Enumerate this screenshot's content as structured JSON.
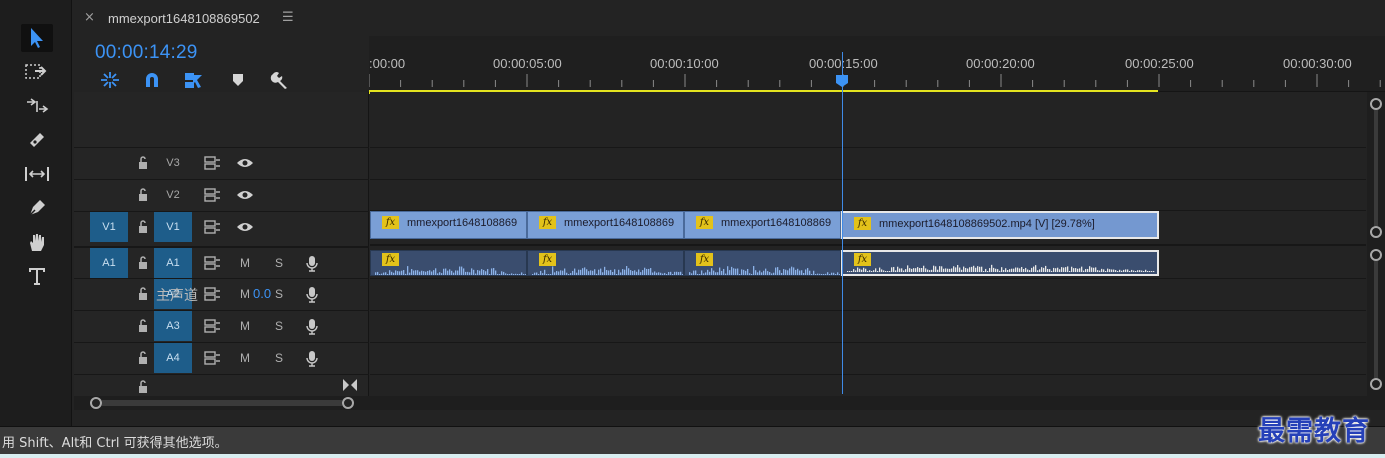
{
  "sequence": {
    "tab_close": "×",
    "title": "mmexport1648108869502",
    "tab_menu": "☰",
    "timecode": "00:00:14:29"
  },
  "ruler": {
    "labels": [
      ":00:00",
      "00:00:05:00",
      "00:00:10:00",
      "00:00:15:00",
      "00:00:20:00",
      "00:00:25:00",
      "00:00:30:00"
    ]
  },
  "tools": [
    "selection-tool",
    "track-select-tool",
    "ripple-edit-tool",
    "razor-tool",
    "slip-tool",
    "pen-tool",
    "hand-tool",
    "type-tool"
  ],
  "tracks": {
    "video": [
      {
        "name": "V3",
        "target": "",
        "source": "V3"
      },
      {
        "name": "V2",
        "target": "",
        "source": "V2"
      },
      {
        "name": "V1",
        "target": "V1",
        "source": "V1"
      }
    ],
    "audio": [
      {
        "name": "A1",
        "target": "A1",
        "source": "A1",
        "m": "M",
        "s": "S"
      },
      {
        "name": "A2",
        "target": "",
        "source": "A2",
        "m": "M",
        "s": "S"
      },
      {
        "name": "A3",
        "target": "",
        "source": "A3",
        "m": "M",
        "s": "S"
      },
      {
        "name": "A4",
        "target": "",
        "source": "A4",
        "m": "M",
        "s": "S"
      }
    ],
    "master_label": "主声道",
    "master_value": "0.0"
  },
  "clips": {
    "fx_label": "fx",
    "video": [
      {
        "name": "mmexport1648108869"
      },
      {
        "name": "mmexport1648108869"
      },
      {
        "name": "mmexport1648108869"
      },
      {
        "name": "mmexport1648108869502.mp4 [V] [29.78%]"
      }
    ]
  },
  "status": {
    "text": "用 Shift、Alt和 Ctrl 可获得其他选项。"
  },
  "watermark": "最需教育",
  "colors": {
    "accent_blue": "#3c93f5",
    "work_area_yellow": "#e4e41f",
    "video_clip": "#7a9fd6",
    "audio_clip": "#3a4d6e",
    "track_target": "#1e5d8a",
    "fx_badge": "#e3c21a"
  }
}
